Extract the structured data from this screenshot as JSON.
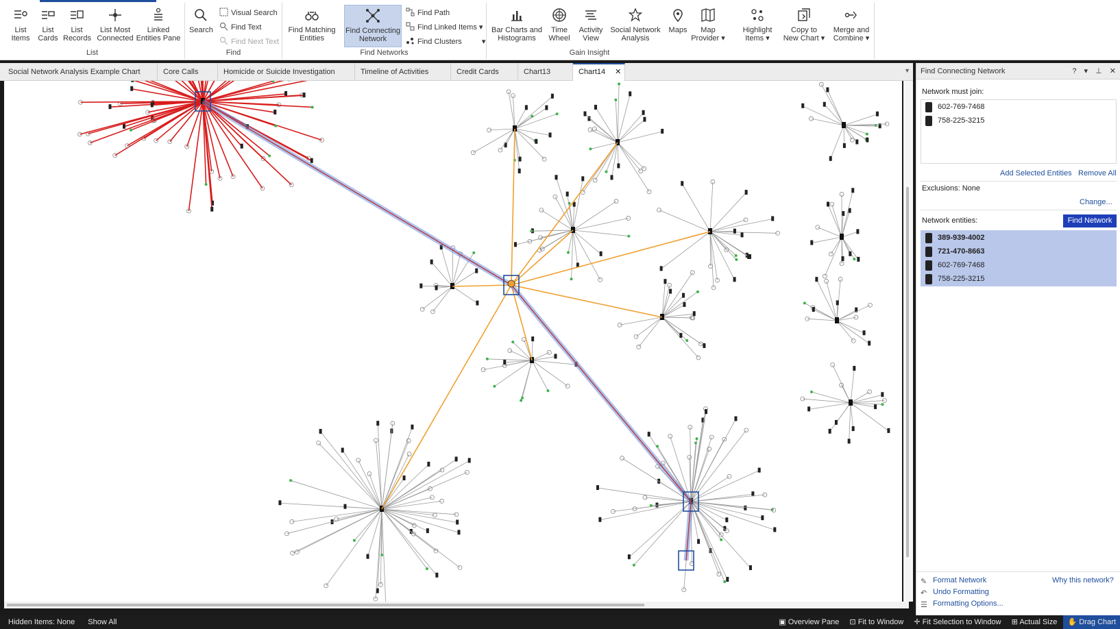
{
  "ribbon": {
    "groups": {
      "list": "List",
      "find": "Find",
      "find_networks": "Find Networks",
      "gain_insight": "Gain Insight"
    },
    "buttons": {
      "list_items": [
        "List",
        "Items"
      ],
      "list_cards": [
        "List",
        "Cards"
      ],
      "list_records": [
        "List",
        "Records"
      ],
      "list_most_connected": [
        "List Most",
        "Connected"
      ],
      "linked_entities_pane": [
        "Linked",
        "Entities Pane"
      ],
      "search": [
        "Search",
        ""
      ],
      "visual_search": "Visual Search",
      "find_text": "Find Text",
      "find_next_text": "Find Next Text",
      "find_matching_entities": [
        "Find Matching",
        "Entities"
      ],
      "find_connecting_network": [
        "Find Connecting",
        "Network"
      ],
      "find_path": "Find Path",
      "find_linked_items": "Find Linked Items",
      "find_clusters": "Find Clusters",
      "bar_charts": [
        "Bar Charts and",
        "Histograms"
      ],
      "time_wheel": [
        "Time",
        "Wheel"
      ],
      "activity_view": [
        "Activity",
        "View"
      ],
      "social_network_analysis": [
        "Social Network",
        "Analysis"
      ],
      "maps": [
        "Maps",
        ""
      ],
      "map_provider": [
        "Map",
        "Provider"
      ],
      "highlight_items": [
        "Highlight",
        "Items"
      ],
      "copy_to_new_chart": [
        "Copy to",
        "New Chart"
      ],
      "merge_and_combine": [
        "Merge and",
        "Combine"
      ]
    }
  },
  "tabs": [
    {
      "label": "Social Network Analysis Example Chart"
    },
    {
      "label": "Core Calls"
    },
    {
      "label": "Homicide or Suicide Investigation"
    },
    {
      "label": "Timeline of Activities"
    },
    {
      "label": "Credit Cards"
    },
    {
      "label": "Chart13"
    },
    {
      "label": "Chart14",
      "active": true
    }
  ],
  "panel": {
    "title": "Find Connecting Network",
    "network_must_join_label": "Network must join:",
    "must_join": [
      "602-769-7468",
      "758-225-3215"
    ],
    "add_selected": "Add Selected Entities",
    "remove_all": "Remove All",
    "exclusions": "Exclusions: None",
    "change": "Change...",
    "network_entities_label": "Network entities:",
    "find_network": "Find Network",
    "entities": [
      {
        "number": "389-939-4002",
        "bold": true
      },
      {
        "number": "721-470-8663",
        "bold": true
      },
      {
        "number": "602-769-7468",
        "bold": false
      },
      {
        "number": "758-225-3215",
        "bold": false
      }
    ],
    "format_network": "Format Network",
    "why_this_network": "Why this network?",
    "undo_formatting": "Undo Formatting",
    "formatting_options": "Formatting Options..."
  },
  "status": {
    "hidden_items": "Hidden Items: None",
    "show_all": "Show All",
    "overview_pane": "Overview Pane",
    "fit_to_window": "Fit to Window",
    "fit_selection": "Fit Selection to Window",
    "actual_size": "Actual Size",
    "drag_chart": "Drag Chart"
  },
  "colors": {
    "accent": "#1f4e9c",
    "selection": "#b9c7ea",
    "red_links": "#d81c1c",
    "orange_links": "#f0a030",
    "path_highlight": "#6f8fe0"
  }
}
